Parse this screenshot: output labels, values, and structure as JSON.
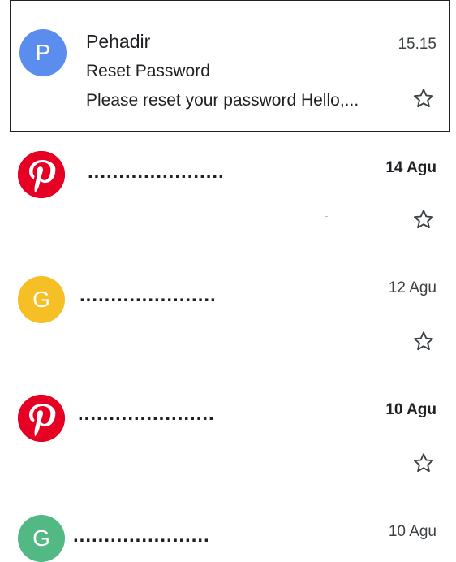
{
  "emails": [
    {
      "avatar_letter": "P",
      "avatar_color": "#5b8def",
      "sender": "Pehadir",
      "time": "15.15",
      "subject": "Reset Password",
      "snippet": "Please reset your password Hello,...",
      "selected": true
    },
    {
      "avatar_icon": "pinterest-logo-icon",
      "avatar_color": "#e60023",
      "sender": "......................",
      "time": "14 Agu",
      "unread": true
    },
    {
      "avatar_letter": "G",
      "avatar_color": "#f6bf26",
      "sender": "......................",
      "time": "12 Agu"
    },
    {
      "avatar_icon": "pinterest-logo-icon",
      "avatar_color": "#e60023",
      "sender": "......................",
      "time": "10 Agu",
      "unread": true
    },
    {
      "avatar_letter": "G",
      "avatar_color": "#52b884",
      "sender": "......................",
      "time": "10 Agu"
    }
  ]
}
